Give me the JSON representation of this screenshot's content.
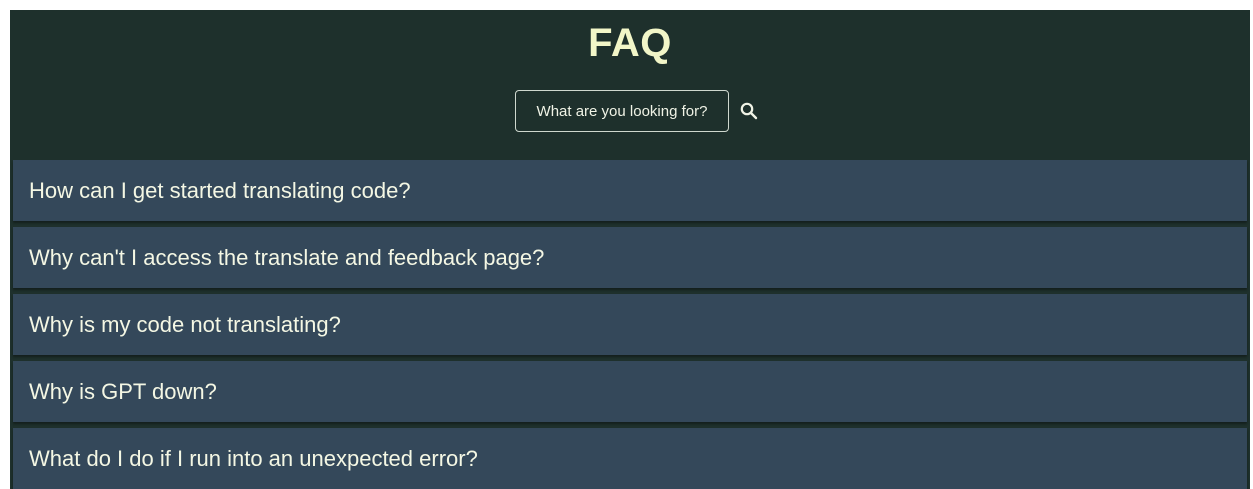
{
  "page": {
    "title": "FAQ"
  },
  "search": {
    "placeholder": "What are you looking for?",
    "value": "",
    "icon": "search-icon"
  },
  "faq": {
    "items": [
      {
        "question": "How can I get started translating code?"
      },
      {
        "question": "Why can't I access the translate and feedback page?"
      },
      {
        "question": "Why is my code not translating?"
      },
      {
        "question": "Why is GPT down?"
      },
      {
        "question": "What do I do if I run into an unexpected error?"
      }
    ]
  },
  "colors": {
    "header_background": "#1e302c",
    "item_background": "#34485a",
    "title_text": "#f2f6c8",
    "item_text": "#f4f7e4"
  }
}
